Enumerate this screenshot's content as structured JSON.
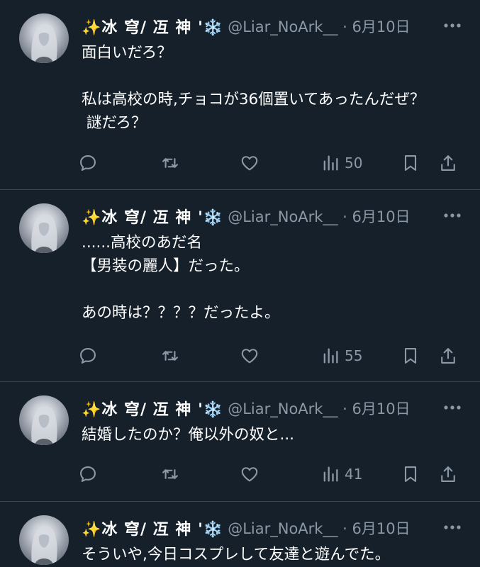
{
  "tweets": [
    {
      "display_name": "✨冰 穹/ 冱 神 '❄️",
      "handle": "@Liar_NoArk__",
      "date": "6月10日",
      "text": "面白いだろ？\n\n私は高校の時,チョコが36個置いてあったんだぜ？\n 謎だろ？",
      "views": "50"
    },
    {
      "display_name": "✨冰 穹/ 冱 神 '❄️",
      "handle": "@Liar_NoArk__",
      "date": "6月10日",
      "text": "......高校のあだ名\n【男装の麗人】だった。\n\nあの時は？？？？だったよ。",
      "views": "55"
    },
    {
      "display_name": "✨冰 穹/ 冱 神 '❄️",
      "handle": "@Liar_NoArk__",
      "date": "6月10日",
      "text": "結婚したのか？俺以外の奴と...",
      "views": "41"
    },
    {
      "display_name": "✨冰 穹/ 冱 神 '❄️",
      "handle": "@Liar_NoArk__",
      "date": "6月10日",
      "text": "そういや,今日コスプレして友達と遊んでた。"
    }
  ],
  "colors": {
    "background": "#15202b",
    "secondary_text": "#8b98a5",
    "divider": "#38444d"
  },
  "icons": [
    "reply-icon",
    "retweet-icon",
    "like-icon",
    "views-icon",
    "bookmark-icon",
    "share-icon",
    "more-icon"
  ]
}
